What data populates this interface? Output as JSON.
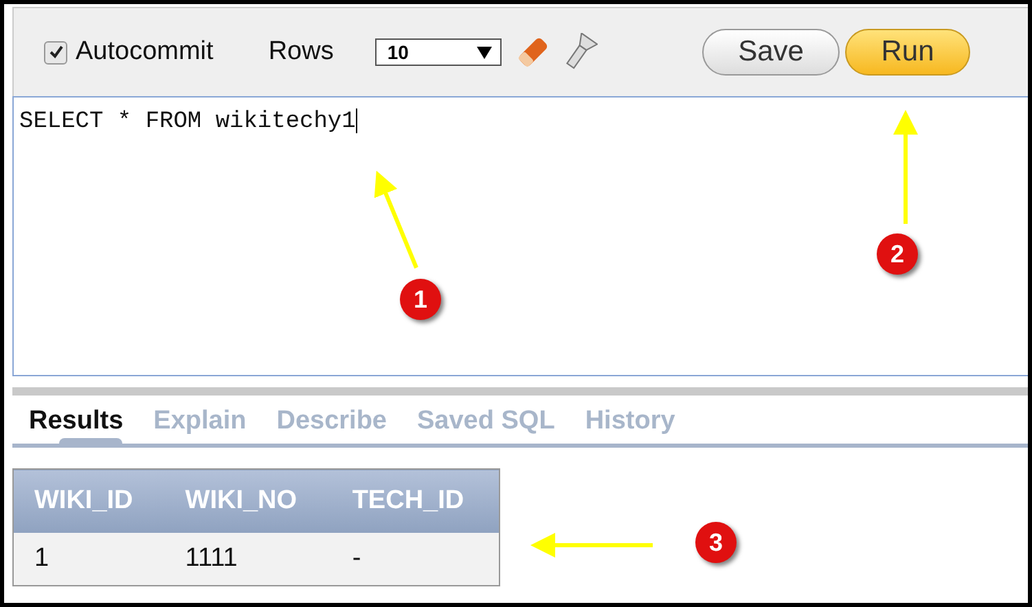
{
  "toolbar": {
    "autocommit": {
      "label": "Autocommit",
      "checked": true
    },
    "rows_label": "Rows",
    "rows_value": "10",
    "buttons": [
      {
        "label": "Save",
        "kind": "plain"
      },
      {
        "label": "Run",
        "kind": "primary"
      }
    ]
  },
  "editor": {
    "value": "SELECT * FROM wikitechy1"
  },
  "tabs": [
    {
      "label": "Results",
      "selected": true
    },
    {
      "label": "Explain",
      "selected": false
    },
    {
      "label": "Describe",
      "selected": false
    },
    {
      "label": "Saved SQL",
      "selected": false
    },
    {
      "label": "History",
      "selected": false
    }
  ],
  "table": {
    "columns": [
      "WIKI_ID",
      "WIKI_NO",
      "TECH_ID"
    ],
    "rows": [
      [
        "1",
        "1111",
        "-"
      ]
    ]
  },
  "annotations": [
    {
      "number": "1"
    },
    {
      "number": "2"
    },
    {
      "number": "3"
    }
  ]
}
